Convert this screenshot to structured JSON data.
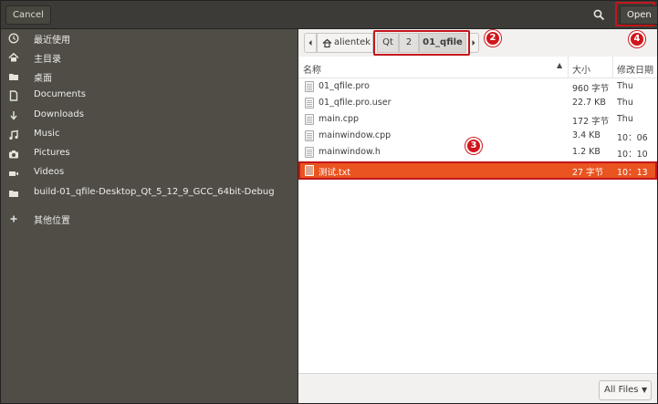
{
  "header": {
    "cancel_label": "Cancel",
    "open_label": "Open",
    "search_icon": "search-icon"
  },
  "sidebar": {
    "items": [
      {
        "icon": "recent-icon",
        "label": "最近使用"
      },
      {
        "icon": "home-icon",
        "label": "主目录"
      },
      {
        "icon": "folder-icon",
        "label": "桌面"
      },
      {
        "icon": "document-icon",
        "label": "Documents"
      },
      {
        "icon": "download-icon",
        "label": "Downloads"
      },
      {
        "icon": "music-icon",
        "label": "Music"
      },
      {
        "icon": "camera-icon",
        "label": "Pictures"
      },
      {
        "icon": "video-icon",
        "label": "Videos"
      },
      {
        "icon": "folder-icon",
        "label": "build-01_qfile-Desktop_Qt_5_12_9_GCC_64bit-Debug"
      },
      {
        "icon": "plus-icon",
        "label": "其他位置"
      }
    ]
  },
  "pathbar": {
    "home_label": "alientek",
    "segments": [
      "Qt",
      "2",
      "01_qfile"
    ]
  },
  "columns": {
    "name": "名称",
    "size": "大小",
    "modified": "修改日期"
  },
  "files": [
    {
      "name": "01_qfile.pro",
      "size": "960 字节",
      "modified": "Thu"
    },
    {
      "name": "01_qfile.pro.user",
      "size": "22.7 KB",
      "modified": "Thu"
    },
    {
      "name": "main.cpp",
      "size": "172 字节",
      "modified": "Thu"
    },
    {
      "name": "mainwindow.cpp",
      "size": "3.4 KB",
      "modified": "10：06"
    },
    {
      "name": "mainwindow.h",
      "size": "1.2 KB",
      "modified": "10：10"
    },
    {
      "name": "测试.txt",
      "size": "27 字节",
      "modified": "10：13",
      "selected": true
    }
  ],
  "footer": {
    "filter_label": "All Files"
  },
  "annotations": [
    "2",
    "3",
    "4"
  ],
  "colors": {
    "accent": "#e95420",
    "annotation": "#d0161c",
    "sidebar_bg": "#4f4d46",
    "header_bg": "#3c3b37"
  }
}
